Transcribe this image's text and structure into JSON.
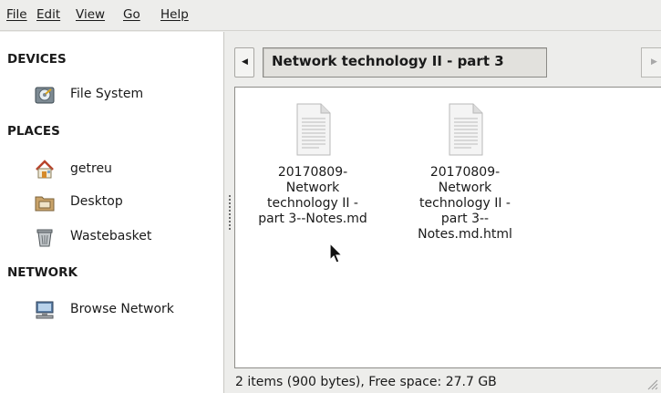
{
  "menubar": {
    "items": [
      "File",
      "Edit",
      "View",
      "Go",
      "Help"
    ]
  },
  "sidebar": {
    "sections": {
      "devices": "DEVICES",
      "places": "PLACES",
      "network": "NETWORK"
    },
    "items": [
      {
        "label": "File System",
        "icon": "hard-drive-icon"
      },
      {
        "label": "getreu",
        "icon": "home-icon"
      },
      {
        "label": "Desktop",
        "icon": "desktop-folder-icon"
      },
      {
        "label": "Wastebasket",
        "icon": "trash-icon"
      },
      {
        "label": "Browse Network",
        "icon": "network-icon"
      }
    ]
  },
  "pathbar": {
    "current": "Network technology II - part 3"
  },
  "files": [
    {
      "name": "20170809-\nNetwork\ntechnology II -\npart 3--Notes.md",
      "icon": "text-file-icon"
    },
    {
      "name": "20170809-\nNetwork\ntechnology II -\npart 3--\nNotes.md.html",
      "icon": "text-file-icon"
    }
  ],
  "status": {
    "text": "2 items (900 bytes), Free space: 27.7 GB"
  }
}
